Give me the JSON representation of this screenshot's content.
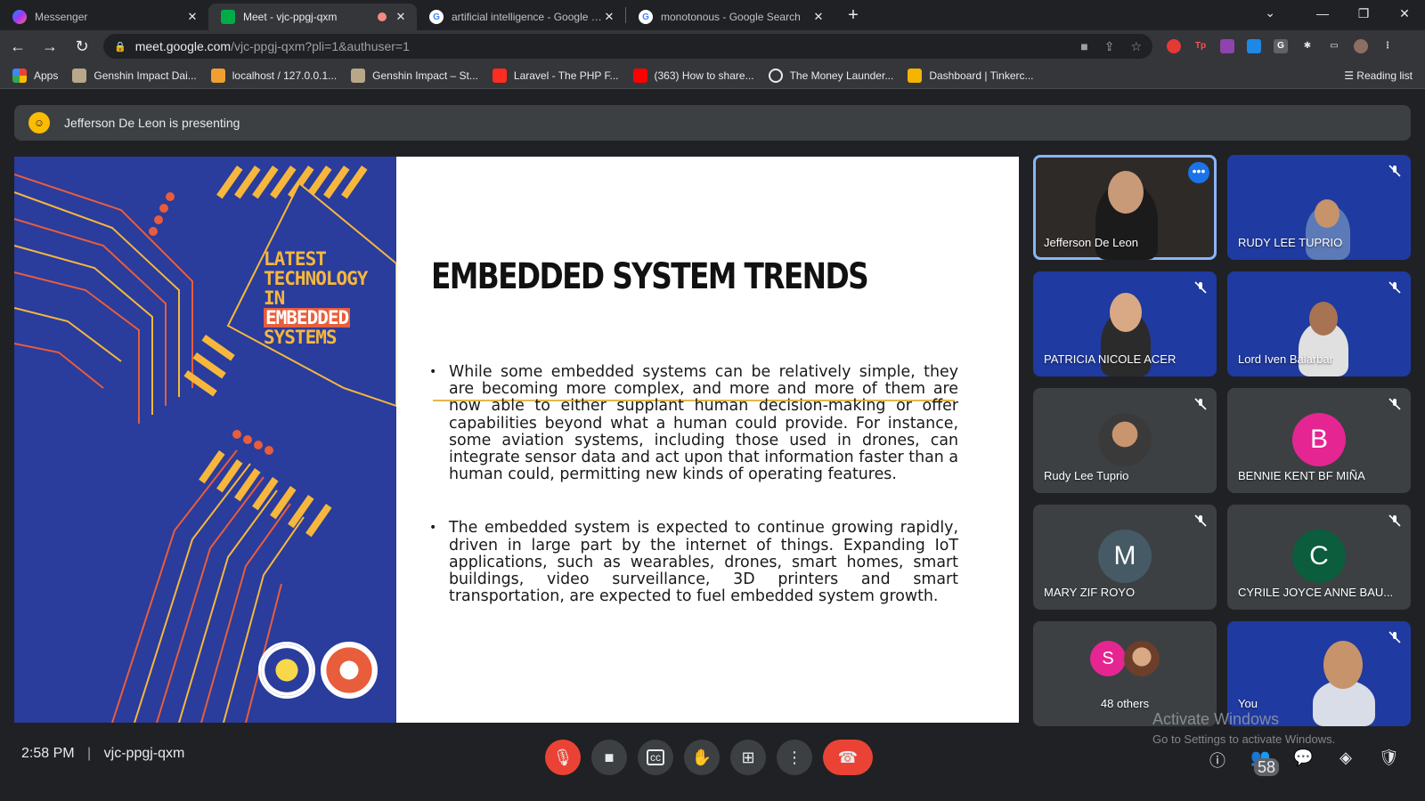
{
  "browser": {
    "tabs": [
      {
        "title": "Messenger",
        "icon": "messenger-icon",
        "color": "#a33bff"
      },
      {
        "title": "Meet - vjc-ppgj-qxm",
        "icon": "meet-icon",
        "color": "#00ac47",
        "active": true,
        "recording": true
      },
      {
        "title": "artificial intelligence - Google Se...",
        "icon": "google-icon",
        "color": "#4285f4"
      },
      {
        "title": "monotonous - Google Search",
        "icon": "google-icon",
        "color": "#4285f4"
      }
    ],
    "url_host": "meet.google.com",
    "url_path": "/vjc-ppgj-qxm?pli=1&authuser=1",
    "bookmarks": [
      {
        "label": "Apps",
        "color": "#4285f4"
      },
      {
        "label": "Genshin Impact Dai...",
        "color": "#b9a78a"
      },
      {
        "label": "localhost / 127.0.0.1...",
        "color": "#f0a030"
      },
      {
        "label": "Genshin Impact – St...",
        "color": "#b9a78a"
      },
      {
        "label": "Laravel - The PHP F...",
        "color": "#ff2d20"
      },
      {
        "label": "(363) How to share...",
        "color": "#ff0000"
      },
      {
        "label": "The Money Launder...",
        "color": "#e8eaed"
      },
      {
        "label": "Dashboard | Tinkerc...",
        "color": "#f4b400"
      }
    ],
    "reading_list": "Reading list"
  },
  "meet": {
    "presenting_text": "Jefferson De Leon is presenting",
    "slide": {
      "cover_lines": [
        "LATEST",
        "TECHNOLOGY",
        "IN",
        "EMBEDDED",
        "SYSTEMS"
      ],
      "heading": "EMBEDDED SYSTEM TRENDS",
      "bullets": [
        "While some embedded systems can be relatively simple, they are becoming more complex, and more and more of them are now able to either supplant human decision-making or offer capabilities beyond what a human could provide. For instance, some aviation systems, including those used in drones, can integrate sensor data and act upon that information faster than a human could, permitting new kinds of operating features.",
        "The embedded system is expected to continue growing rapidly, driven in large part by the internet of things. Expanding IoT applications, such as wearables, drones, smart homes, smart buildings, video surveillance, 3D printers and smart transportation, are expected to fuel embedded system growth."
      ]
    },
    "participants": [
      {
        "name": "Jefferson De Leon",
        "type": "video",
        "active": true
      },
      {
        "name": "RUDY LEE TUPRIO",
        "type": "video",
        "muted": true
      },
      {
        "name": "PATRICIA NICOLE ACER",
        "type": "video",
        "muted": true
      },
      {
        "name": "Lord Iven Balarbar",
        "type": "video",
        "muted": true
      },
      {
        "name": "Rudy Lee Tuprio",
        "type": "photo",
        "muted": true
      },
      {
        "name": "BENNIE KENT BF MIÑA",
        "initial": "B",
        "color": "#e52592",
        "muted": true
      },
      {
        "name": "MARY ZIF ROYO",
        "initial": "M",
        "color": "#455a64",
        "muted": true
      },
      {
        "name": "CYRILE JOYCE ANNE BAU...",
        "initial": "C",
        "color": "#0b5d3e",
        "muted": true
      },
      {
        "name": "48 others",
        "initial": "S",
        "color": "#e52592"
      },
      {
        "name": "You",
        "type": "video",
        "muted": true
      }
    ],
    "time": "2:58 PM",
    "separator": "|",
    "meeting_code": "vjc-ppgj-qxm",
    "people_count": "58"
  },
  "os": {
    "activate_title": "Activate Windows",
    "activate_sub": "Go to Settings to activate Windows."
  }
}
